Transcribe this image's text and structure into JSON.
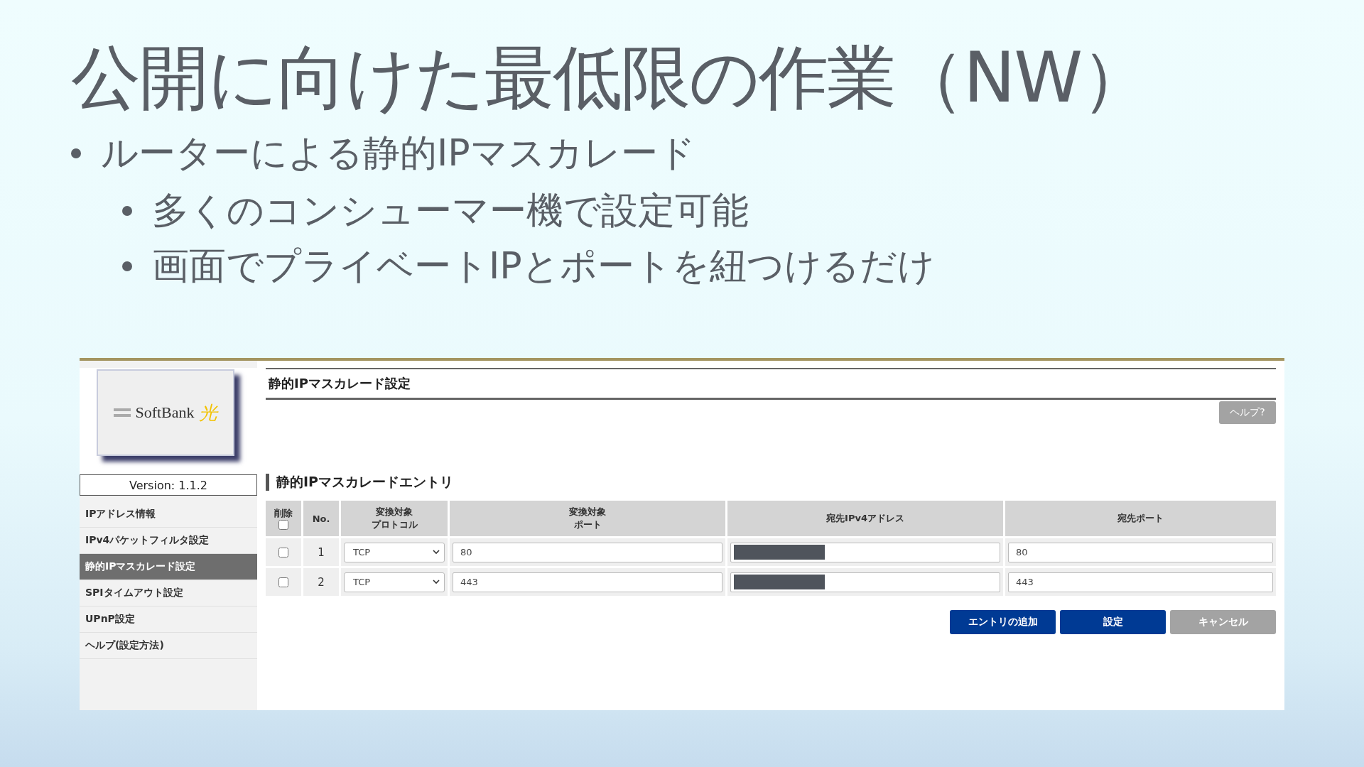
{
  "slide": {
    "title": "公開に向けた最低限の作業（NW）",
    "bullets": [
      {
        "text": "ルーターによる静的IPマスカレード",
        "children": [
          {
            "text": "多くのコンシューマー機で設定可能"
          },
          {
            "text": "画面でプライベートIPとポートを紐つけるだけ"
          }
        ]
      }
    ]
  },
  "router": {
    "logo": {
      "brand": "SoftBank",
      "mark": "光"
    },
    "version": "Version: 1.1.2",
    "nav": [
      {
        "label": "IPアドレス情報",
        "selected": false
      },
      {
        "label": "IPv4パケットフィルタ設定",
        "selected": false
      },
      {
        "label": "静的IPマスカレード設定",
        "selected": true
      },
      {
        "label": "SPIタイムアウト設定",
        "selected": false
      },
      {
        "label": "UPnP設定",
        "selected": false
      },
      {
        "label": "ヘルプ(設定方法)",
        "selected": false
      }
    ],
    "page_title": "静的IPマスカレード設定",
    "help_button": "ヘルプ?",
    "section_title": "静的IPマスカレードエントリ",
    "table": {
      "columns": [
        {
          "kind": "delete",
          "label": "削除",
          "checked": false
        },
        {
          "kind": "text",
          "label": "No."
        },
        {
          "kind": "stacked",
          "lines": [
            "変換対象",
            "プロトコル"
          ]
        },
        {
          "kind": "stacked",
          "lines": [
            "変換対象",
            "ポート"
          ]
        },
        {
          "kind": "text",
          "label": "宛先IPv4アドレス"
        },
        {
          "kind": "text",
          "label": "宛先ポート"
        }
      ],
      "rows": [
        {
          "checked": false,
          "no": "1",
          "protocol": "TCP",
          "port": "80",
          "address_redacted": true,
          "dest_port": "80"
        },
        {
          "checked": false,
          "no": "2",
          "protocol": "TCP",
          "port": "443",
          "address_redacted": true,
          "dest_port": "443"
        }
      ]
    },
    "buttons": [
      {
        "label": "エントリの追加",
        "kind": "primary"
      },
      {
        "label": "設定",
        "kind": "primary"
      },
      {
        "label": "キャンセル",
        "kind": "secondary"
      }
    ]
  }
}
